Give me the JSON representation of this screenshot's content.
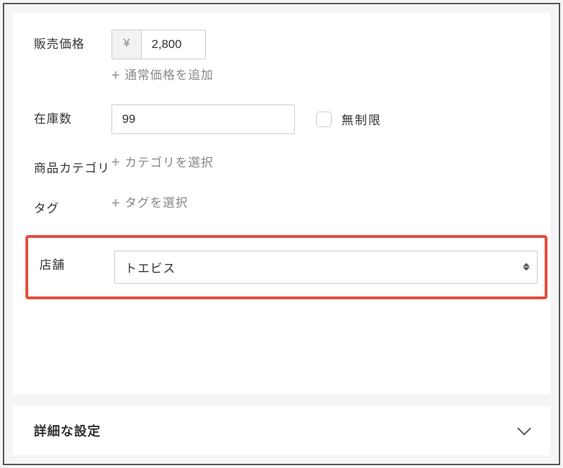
{
  "form": {
    "price": {
      "label": "販売価格",
      "currency_symbol": "¥",
      "value": "2,800",
      "add_regular_price": "通常価格を追加"
    },
    "stock": {
      "label": "在庫数",
      "value": "99",
      "unlimited_label": "無制限",
      "unlimited_checked": false
    },
    "category": {
      "label": "商品カテゴリ",
      "select_text": "カテゴリを選択"
    },
    "tag": {
      "label": "タグ",
      "select_text": "タグを選択"
    },
    "store": {
      "label": "店舗",
      "selected": "トエビス"
    }
  },
  "accordion": {
    "advanced_settings": "詳細な設定"
  }
}
